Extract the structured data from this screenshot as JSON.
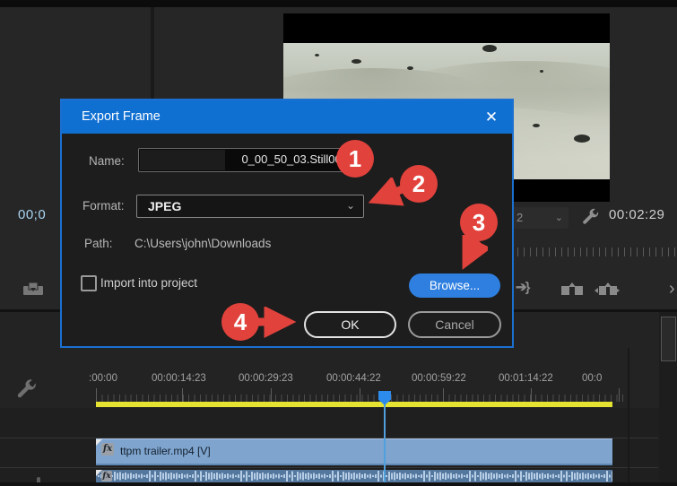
{
  "dialog": {
    "title": "Export Frame",
    "close_glyph": "✕",
    "name_label": "Name:",
    "name_value": "0_00_50_03.Still001",
    "format_label": "Format:",
    "format_value": "JPEG",
    "chevron_glyph": "⌄",
    "path_label": "Path:",
    "path_value": "C:\\Users\\john\\Downloads",
    "import_label": "Import into project",
    "browse_label": "Browse...",
    "ok_label": "OK",
    "cancel_label": "Cancel"
  },
  "steps": {
    "one": "1",
    "two": "2",
    "three": "3",
    "four": "4"
  },
  "monitor": {
    "resolution_value": "2",
    "resolution_chevron": "⌄",
    "duration_timecode": "00:02:29",
    "source_timecode": "00;0",
    "insert_glyph": "➔}",
    "more_chevron": "›"
  },
  "timeline": {
    "ruler_labels": [
      ":00:00",
      "00:00:14:23",
      "00:00:29:23",
      "00:00:44:22",
      "00:00:59:22",
      "00:01:14:22",
      "00:0"
    ],
    "video_clip_label": "ttpm trailer.mp4 [V]",
    "fx_badge": "fx"
  },
  "colors": {
    "title_bar_blue": "#1070d2",
    "browse_blue": "#2e7fe0",
    "annotation_red": "#e2423c",
    "workarea_yellow": "#e6e232",
    "video_clip_blue": "#7fa5cf",
    "audio_clip_blue": "#54779e",
    "playhead_blue": "#2d8ceb"
  }
}
